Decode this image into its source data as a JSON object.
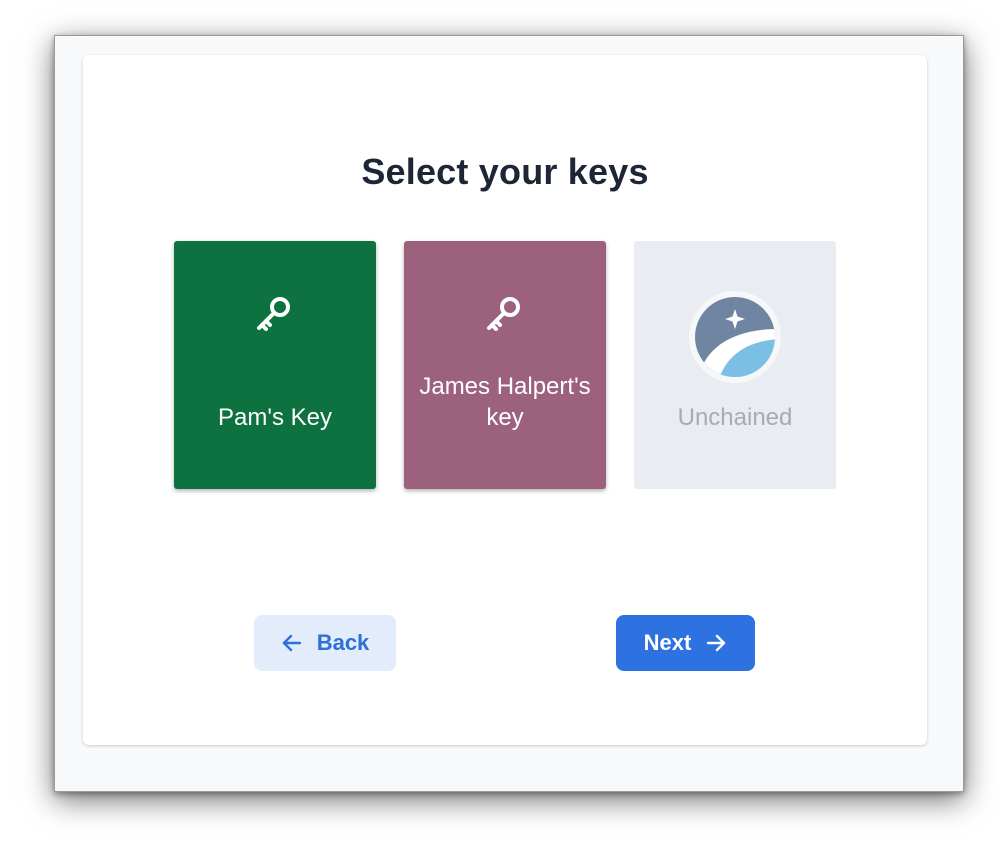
{
  "page": {
    "title": "Select your keys"
  },
  "keys": [
    {
      "label": "Pam's Key",
      "color": "#0e7240",
      "icon": "key-icon"
    },
    {
      "label": "James Halpert's key",
      "color": "#9c627d",
      "icon": "key-icon"
    },
    {
      "label": "Unchained",
      "color": "#e9ecf1",
      "icon": "unchained-logo-icon",
      "disabled": true
    }
  ],
  "buttons": {
    "back_label": "Back",
    "back_icon": "arrow-left-icon",
    "next_label": "Next",
    "next_icon": "arrow-right-icon"
  },
  "colors": {
    "accent": "#2d72e0",
    "back_bg": "#e2ecfa",
    "title": "#1c2636"
  }
}
